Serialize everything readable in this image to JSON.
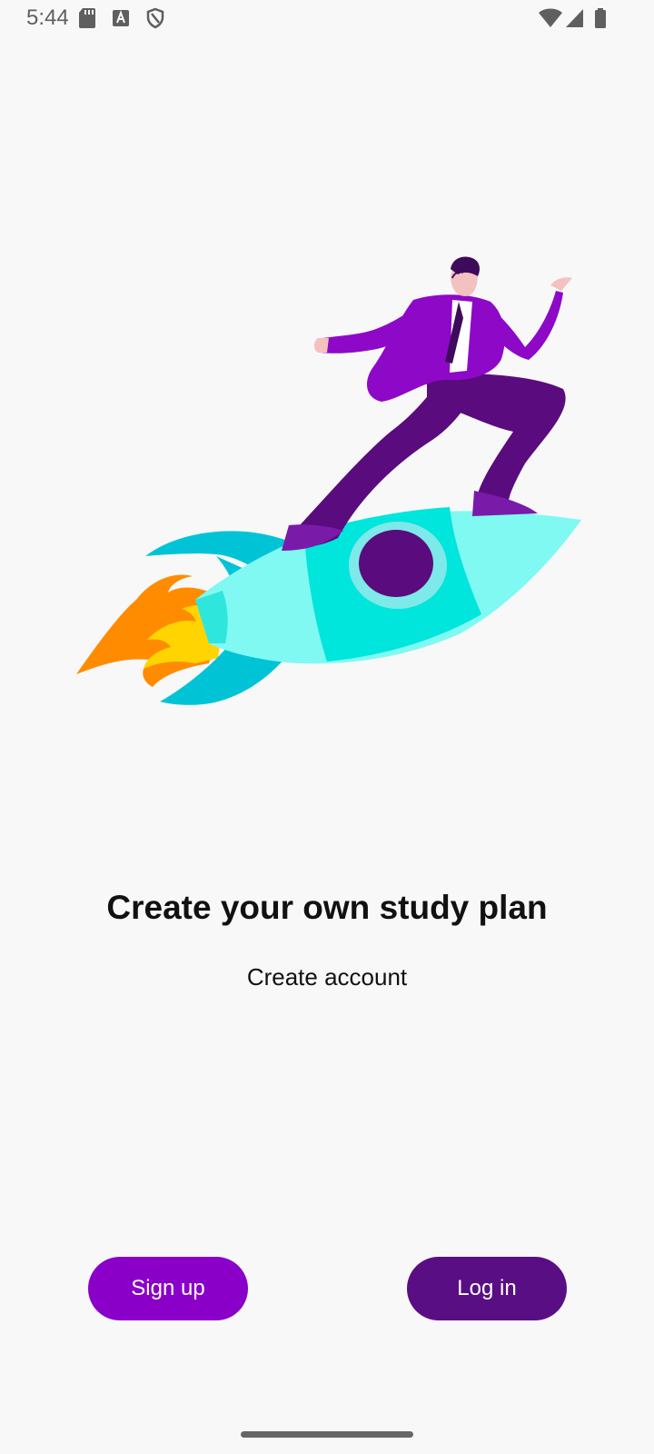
{
  "status_bar": {
    "time": "5:44",
    "left_icons": [
      "sd-card-icon",
      "font-a-icon",
      "shield-icon"
    ],
    "right_icons": [
      "wifi-icon",
      "cellular-signal-icon",
      "battery-icon"
    ]
  },
  "illustration": {
    "name": "man-riding-rocket-illustration"
  },
  "onboarding": {
    "title": "Create your own study plan",
    "subtitle": "Create account"
  },
  "actions": {
    "signup_label": "Sign up",
    "login_label": "Log in"
  },
  "colors": {
    "background": "#f8f8f8",
    "signup_button": "#8a00c8",
    "login_button": "#5a0e84",
    "rocket_body": "#00e5dc",
    "rocket_fins": "#00c4d6",
    "suit_purple": "#8e08c8",
    "pants_dark": "#5a0b7e",
    "flame_orange": "#ff8c00",
    "flame_yellow": "#ffd700"
  }
}
